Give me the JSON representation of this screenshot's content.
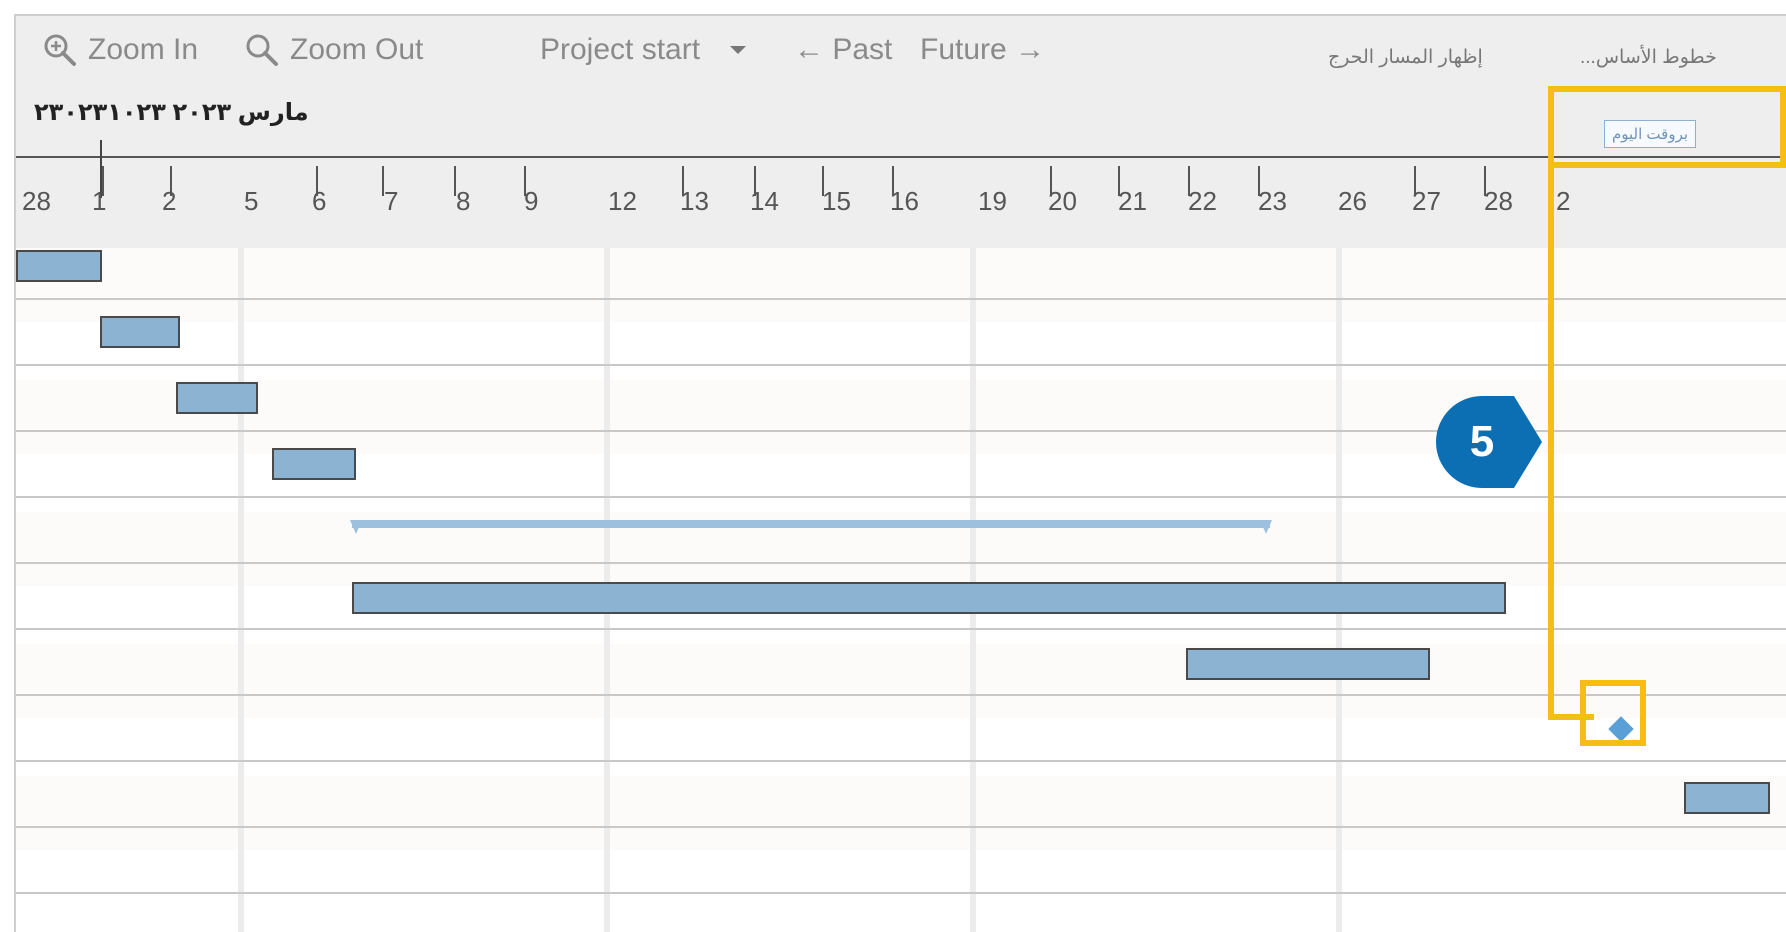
{
  "toolbar": {
    "zoom_in_label": "Zoom In",
    "zoom_out_label": "Zoom Out",
    "project_start_label": "Project start",
    "past_label": "← Past",
    "future_label": "Future →",
    "show_critical_path_label": "إظهار المسار الحرج",
    "baselines_label": "خطوط الأساس..."
  },
  "timeline": {
    "month_label": "مارس ٢٠٢٣ ٢٣٠٢٣١٠٢٣",
    "today_button_label": "بروقت اليوم",
    "day_ticks": [
      "28",
      "1",
      "2",
      "5",
      "6",
      "7",
      "8",
      "9",
      "12",
      "13",
      "14",
      "15",
      "16",
      "19",
      "20",
      "21",
      "22",
      "23",
      "26",
      "27",
      "28",
      "2"
    ]
  },
  "callout": {
    "number": "5"
  },
  "colors": {
    "bar_fill": "#8db3d3",
    "summary": "#9cc0de",
    "milestone": "#5a9fd6",
    "highlight": "#f5be12",
    "callout": "#0c6fb4"
  },
  "tasks": [
    {
      "type": "bar",
      "start": "28",
      "end": "1"
    },
    {
      "type": "bar",
      "start": "1",
      "end": "2"
    },
    {
      "type": "bar",
      "start": "2",
      "end": "3"
    },
    {
      "type": "bar",
      "start": "5",
      "end": "6"
    },
    {
      "type": "summary",
      "start": "6",
      "end": "21"
    },
    {
      "type": "bar",
      "start": "6",
      "end": "26"
    },
    {
      "type": "bar",
      "start": "20",
      "end": "23"
    },
    {
      "type": "milestone",
      "start": "27"
    },
    {
      "type": "bar",
      "start": "28",
      "end": "29"
    }
  ]
}
